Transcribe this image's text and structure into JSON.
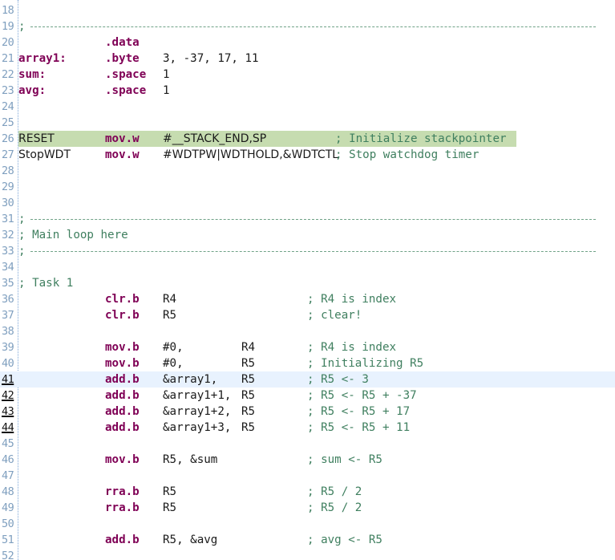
{
  "editor": {
    "lines": [
      {
        "n": "18"
      },
      {
        "n": "19",
        "sep": true,
        "comment": ";"
      },
      {
        "n": "20",
        "instr": ".data"
      },
      {
        "n": "21",
        "label": "array1:",
        "instr": ".byte",
        "ops": "3, -37, 17, 11"
      },
      {
        "n": "22",
        "label": "sum:",
        "instr": ".space",
        "ops": "1"
      },
      {
        "n": "23",
        "label": "avg:",
        "instr": ".space",
        "ops": "1"
      },
      {
        "n": "24"
      },
      {
        "n": "25"
      },
      {
        "n": "26",
        "highlight": true,
        "label": "RESET",
        "label_plain": true,
        "instr": "mov.w",
        "ops": "#__STACK_END,SP",
        "ops_sans": true,
        "comment": "; Initialize stackpointer",
        "ccol": "c418"
      },
      {
        "n": "27",
        "label": "StopWDT",
        "label_plain": true,
        "instr": "mov.w",
        "ops": "#WDTPW|WDTHOLD,&WDTCTL",
        "ops_sans": true,
        "comment": "; Stop watchdog timer",
        "ccol": "c418"
      },
      {
        "n": "28"
      },
      {
        "n": "29"
      },
      {
        "n": "30"
      },
      {
        "n": "31",
        "sep": true,
        "comment": ";"
      },
      {
        "n": "32",
        "comment": "; Main loop here",
        "ccol": "fromstart"
      },
      {
        "n": "33",
        "sep": true,
        "comment": ";"
      },
      {
        "n": "34"
      },
      {
        "n": "35",
        "comment": "; Task 1",
        "ccol": "fromstart"
      },
      {
        "n": "36",
        "instr": "clr.b",
        "ops": "R4",
        "comment": "; R4 is index",
        "ccol": "c383"
      },
      {
        "n": "37",
        "instr": "clr.b",
        "ops": "R5",
        "comment": "; clear!",
        "ccol": "c383"
      },
      {
        "n": "38"
      },
      {
        "n": "39",
        "instr": "mov.b",
        "ops": "#0,",
        "op2": "R4",
        "comment": "; R4 is index",
        "ccol": "c383"
      },
      {
        "n": "40",
        "instr": "mov.b",
        "ops": "#0,",
        "op2": "R5",
        "comment": "; Initializing R5",
        "ccol": "c383"
      },
      {
        "n": "41",
        "current": true,
        "bp": true,
        "instr": "add.b",
        "ops": "&array1,",
        "op2": "R5",
        "comment": "; R5 <- 3",
        "ccol": "c383"
      },
      {
        "n": "42",
        "bp": true,
        "instr": "add.b",
        "ops": "&array1+1,",
        "op2": "R5",
        "comment": "; R5 <- R5 + -37",
        "ccol": "c383"
      },
      {
        "n": "43",
        "bp": true,
        "instr": "add.b",
        "ops": "&array1+2,",
        "op2": "R5",
        "comment": "; R5 <- R5 + 17",
        "ccol": "c383"
      },
      {
        "n": "44",
        "bp": true,
        "instr": "add.b",
        "ops": "&array1+3,",
        "op2": "R5",
        "comment": "; R5 <- R5 + 11",
        "ccol": "c383"
      },
      {
        "n": "45"
      },
      {
        "n": "46",
        "instr": "mov.b",
        "ops": "R5, &sum",
        "comment": "; sum <- R5",
        "ccol": "c383"
      },
      {
        "n": "47"
      },
      {
        "n": "48",
        "instr": "rra.b",
        "ops": "R5",
        "comment": "; R5 / 2",
        "ccol": "c383"
      },
      {
        "n": "49",
        "instr": "rra.b",
        "ops": "R5",
        "comment": "; R5 / 2",
        "ccol": "c383"
      },
      {
        "n": "50"
      },
      {
        "n": "51",
        "instr": "add.b",
        "ops": "R5, &avg",
        "comment": "; avg <- R5",
        "ccol": "c383"
      },
      {
        "n": "52"
      }
    ]
  }
}
